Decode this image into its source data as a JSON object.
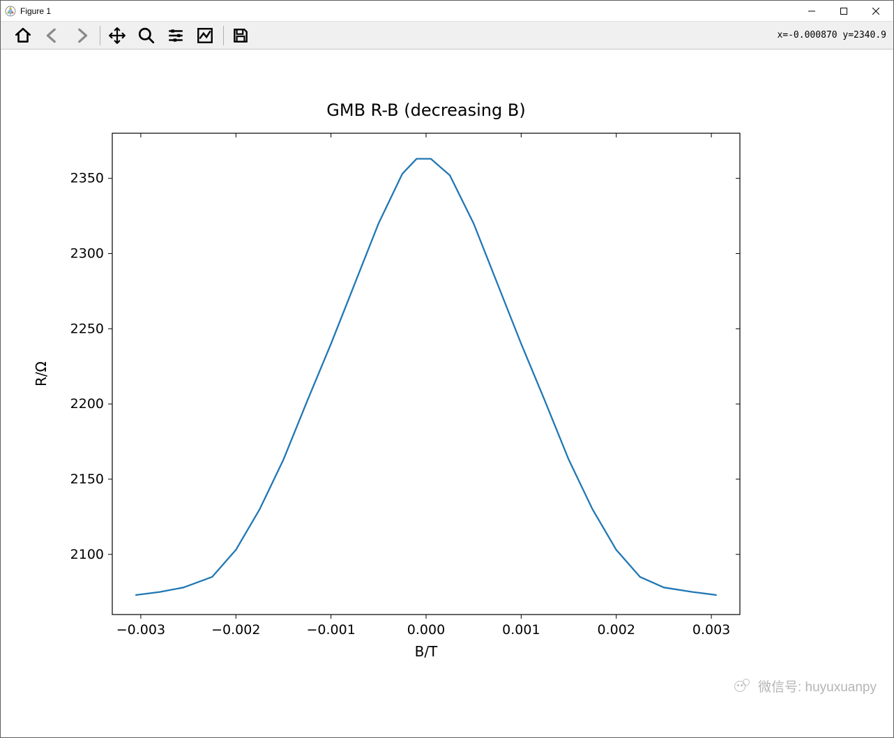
{
  "window": {
    "title": "Figure 1"
  },
  "toolbar": {
    "coord_readout": "x=-0.000870 y=2340.9"
  },
  "watermark": {
    "text": "微信号: huyuxuanpy"
  },
  "chart_data": {
    "type": "line",
    "title": "GMB R-B (decreasing B)",
    "xlabel": "B/T",
    "ylabel": "R/Ω",
    "xlim": [
      -0.0033,
      0.0033
    ],
    "ylim": [
      2060,
      2380
    ],
    "xticks": [
      -0.003,
      -0.002,
      -0.001,
      0.0,
      0.001,
      0.002,
      0.003
    ],
    "xtick_labels": [
      "−0.003",
      "−0.002",
      "−0.001",
      "0.000",
      "0.001",
      "0.002",
      "0.003"
    ],
    "yticks": [
      2100,
      2150,
      2200,
      2250,
      2300,
      2350
    ],
    "ytick_labels": [
      "2100",
      "2150",
      "2200",
      "2250",
      "2300",
      "2350"
    ],
    "series": [
      {
        "name": "R vs B",
        "color": "#1f77b4",
        "x": [
          -0.00305,
          -0.0028,
          -0.00255,
          -0.00225,
          -0.002,
          -0.00175,
          -0.0015,
          -0.00125,
          -0.001,
          -0.00075,
          -0.0005,
          -0.00025,
          -0.0001,
          5e-05,
          0.00025,
          0.0005,
          0.00075,
          0.001,
          0.00125,
          0.0015,
          0.00175,
          0.002,
          0.00225,
          0.0025,
          0.0028,
          0.00305
        ],
        "y": [
          2073,
          2075,
          2078,
          2085,
          2103,
          2130,
          2163,
          2202,
          2240,
          2280,
          2320,
          2353,
          2363,
          2363,
          2352,
          2320,
          2280,
          2240,
          2202,
          2163,
          2130,
          2103,
          2085,
          2078,
          2075,
          2073
        ]
      }
    ]
  }
}
